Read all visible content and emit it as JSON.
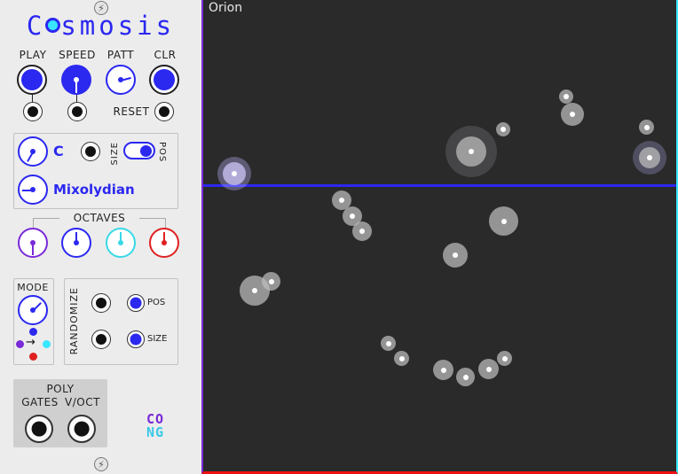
{
  "module": {
    "title_pre": "C",
    "title_post": "smosis",
    "brand_top": "CO",
    "brand_bottom": "NG"
  },
  "transport": {
    "play_label": "PLAY",
    "speed_label": "SPEED",
    "patt_label": "PATT",
    "clr_label": "CLR",
    "reset_label": "RESET"
  },
  "scale": {
    "root_note": "C",
    "mode_name": "Mixolydian",
    "toggle_left": "SIZE",
    "toggle_right": "POS"
  },
  "octaves": {
    "label": "OCTAVES",
    "colors": [
      "#7a2ad8",
      "#2b28f0",
      "#38d8e8",
      "#e02020"
    ]
  },
  "mode_section": {
    "label": "MODE",
    "arrow": "→"
  },
  "randomize": {
    "label": "RANDOMIZE",
    "pos_label": "POS",
    "size_label": "SIZE"
  },
  "poly": {
    "label": "POLY",
    "gates_label": "GATES",
    "voct_label": "V/OCT"
  },
  "display": {
    "constellation_name": "Orion",
    "playhead_color": "#2b28f0"
  },
  "colors": {
    "accent": "#2b28f0",
    "purple": "#7a2ad8",
    "cyan": "#38d8e8",
    "red": "#e02020"
  }
}
